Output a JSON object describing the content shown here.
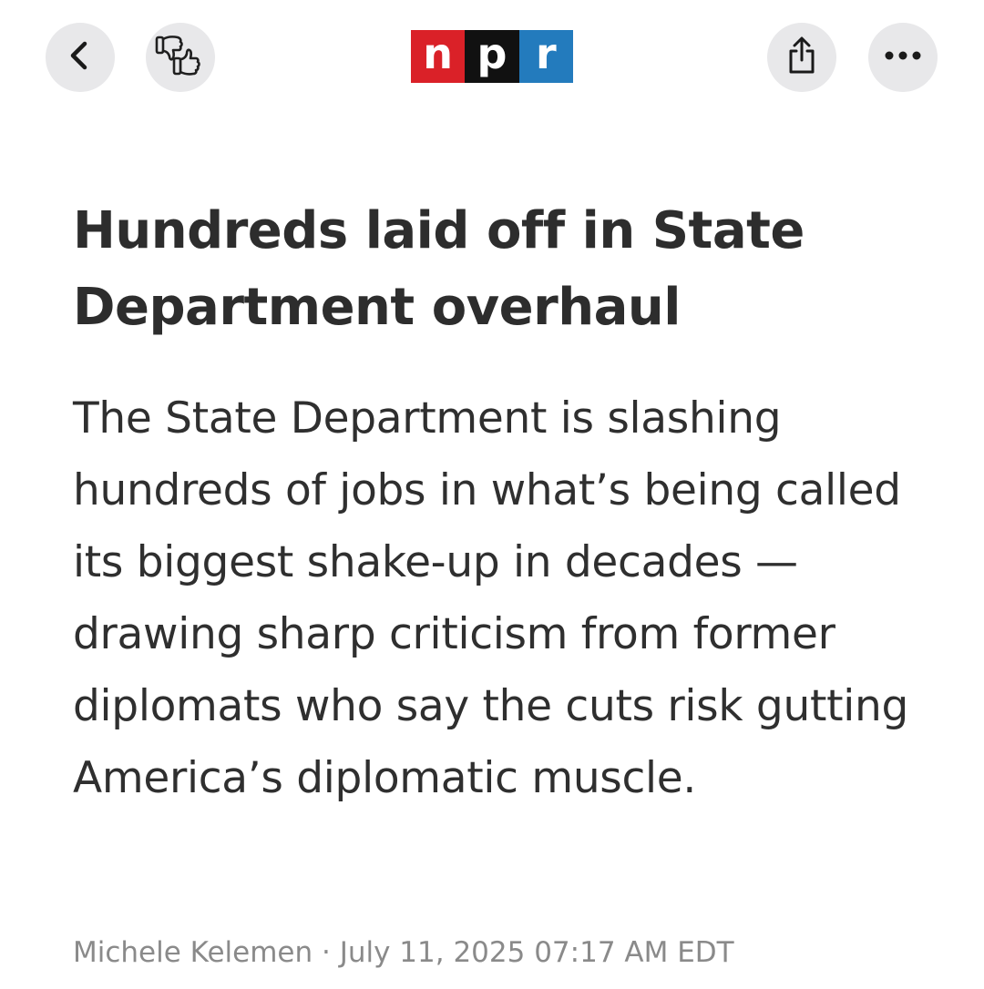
{
  "toolbar": {
    "back_icon": "chevron-left-icon",
    "feedback_icon": "thumbs-down-up-icon",
    "share_icon": "share-icon",
    "more_icon": "ellipsis-icon"
  },
  "logo": {
    "letters": [
      "n",
      "p",
      "r"
    ],
    "colors": [
      "#da2128",
      "#111111",
      "#237bbd"
    ]
  },
  "article": {
    "headline": "Hundreds laid off in State Department overhaul",
    "summary": "The State Department is slashing hundreds of jobs in what’s being called its biggest shake-up in decades — drawing sharp criticism from former diplomats who say the cuts risk gutting America’s diplomatic muscle.",
    "author": "Michele Kelemen",
    "separator": "·",
    "date": "July 11, 2025 07:17 AM EDT"
  }
}
